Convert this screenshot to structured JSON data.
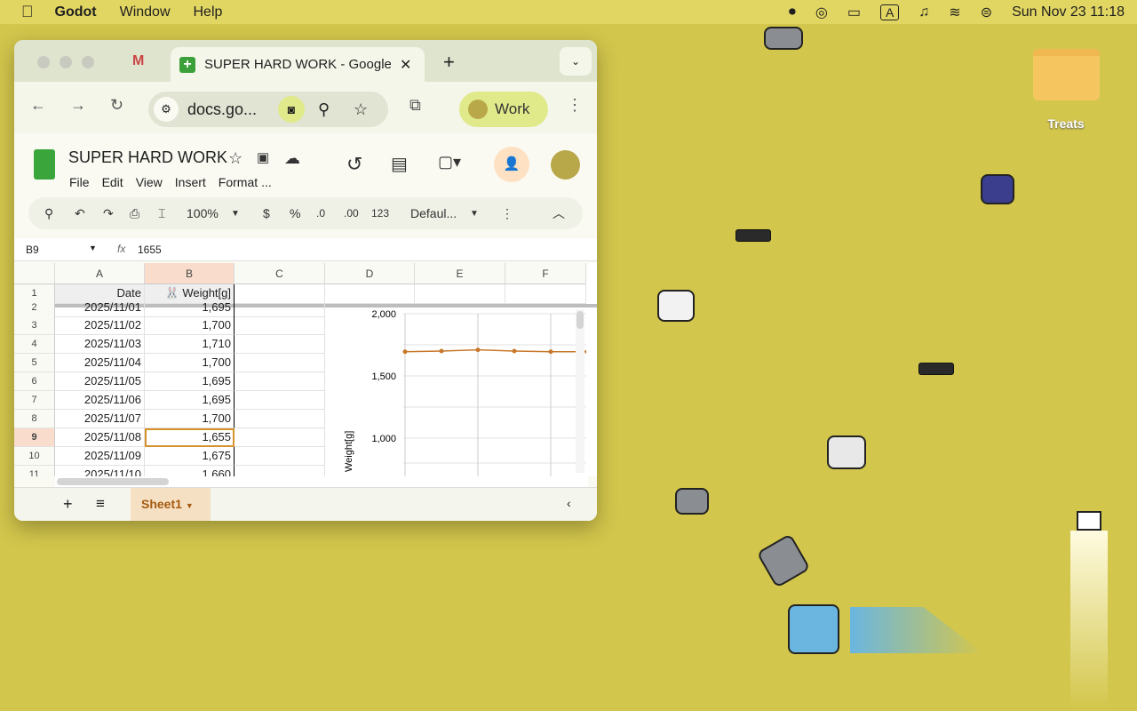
{
  "menubar": {
    "app": "Godot",
    "items": [
      "Window",
      "Help"
    ],
    "clock": "Sun Nov 23  11:18",
    "input_source": "A"
  },
  "browser": {
    "tab_title": "SUPER HARD WORK - Google",
    "url": "docs.go...",
    "profile": "Work"
  },
  "doc": {
    "title": "SUPER HARD WORK",
    "menus": [
      "File",
      "Edit",
      "View",
      "Insert",
      "Format",
      "..."
    ]
  },
  "toolbar": {
    "zoom": "100%",
    "currency": "$",
    "percent": "%",
    "dec_less": ".0",
    "dec_more": ".00",
    "number_format": "123",
    "font": "Defaul..."
  },
  "formula": {
    "cell_ref": "B9",
    "value": "1655"
  },
  "grid": {
    "columns": [
      "A",
      "B",
      "C",
      "D",
      "E",
      "F"
    ],
    "header": {
      "date": "Date",
      "weight": "🐰 Weight[g]"
    },
    "rows": [
      {
        "n": "2",
        "date": "2025/11/01",
        "weight": "1,695"
      },
      {
        "n": "3",
        "date": "2025/11/02",
        "weight": "1,700"
      },
      {
        "n": "4",
        "date": "2025/11/03",
        "weight": "1,710"
      },
      {
        "n": "5",
        "date": "2025/11/04",
        "weight": "1,700"
      },
      {
        "n": "6",
        "date": "2025/11/05",
        "weight": "1,695"
      },
      {
        "n": "7",
        "date": "2025/11/06",
        "weight": "1,695"
      },
      {
        "n": "8",
        "date": "2025/11/07",
        "weight": "1,700"
      },
      {
        "n": "9",
        "date": "2025/11/08",
        "weight": "1,655"
      },
      {
        "n": "10",
        "date": "2025/11/09",
        "weight": "1,675"
      },
      {
        "n": "11",
        "date": "2025/11/10",
        "weight": "1,660"
      }
    ],
    "selected_row": "9"
  },
  "chart_data": {
    "type": "line",
    "ylabel": "Weight[g]",
    "yticks": [
      "2,000",
      "1,500",
      "1,000"
    ],
    "ylim": [
      750,
      2080
    ],
    "values": [
      1695,
      1700,
      1710,
      1700,
      1695,
      1695
    ],
    "color": "#c8782a",
    "grid": true
  },
  "sheets": {
    "active": "Sheet1"
  },
  "desktop": {
    "folder_label": "Treats"
  }
}
